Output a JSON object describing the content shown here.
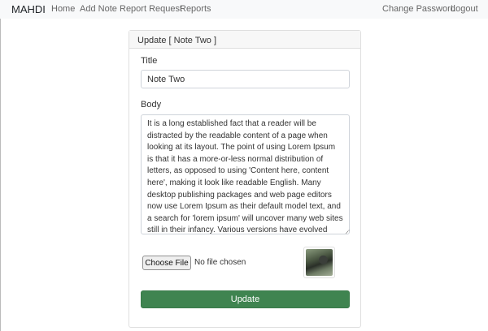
{
  "navbar": {
    "brand": "MAHDI",
    "links": [
      "Home",
      "Add Note",
      "Report Request",
      "Reports"
    ],
    "right_links": [
      "Change Password",
      "Logout"
    ]
  },
  "card": {
    "header": "Update [ Note Two ]",
    "title_label": "Title",
    "title_value": "Note Two",
    "body_label": "Body",
    "body_value": "It is a long established fact that a reader will be distracted by the readable content of a page when looking at its layout. The point of using Lorem Ipsum is that it has a more-or-less normal distribution of letters, as opposed to using 'Content here, content here', making it look like readable English. Many desktop publishing packages and web page editors now use Lorem Ipsum as their default model text, and a search for 'lorem ipsum' will uncover many web sites still in their infancy. Various versions have evolved over the years, sometimes by",
    "file_button": "Choose File",
    "file_status": "No file chosen",
    "submit_label": "Update"
  },
  "colors": {
    "navbar_bg": "#f8f9fa",
    "button_green": "#3f8450"
  }
}
